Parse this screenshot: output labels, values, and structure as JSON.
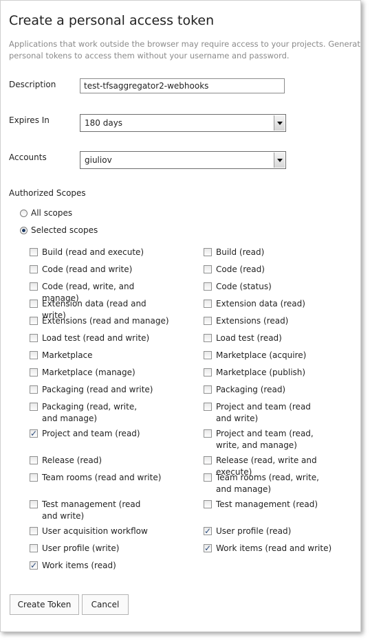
{
  "page": {
    "title": "Create a personal access token",
    "subtitle": "Applications that work outside the browser may require access to your projects. Generate personal tokens to access them without your username and password."
  },
  "form": {
    "description": {
      "label": "Description",
      "value": "test-tfsaggregator2-webhooks"
    },
    "expires": {
      "label": "Expires In",
      "value": "180 days"
    },
    "accounts": {
      "label": "Accounts",
      "value": "giuliov"
    },
    "scopes_label": "Authorized Scopes",
    "all_scopes": {
      "label": "All scopes",
      "checked": false
    },
    "selected_scopes": {
      "label": "Selected scopes",
      "checked": true
    }
  },
  "scopes_left": [
    {
      "label": "Build (read and execute)",
      "checked": false
    },
    {
      "label": "Code (read and write)",
      "checked": false
    },
    {
      "label": "Code (read, write, and manage)",
      "checked": false
    },
    {
      "label": "Extension data (read and write)",
      "checked": false
    },
    {
      "label": "Extensions (read and manage)",
      "checked": false
    },
    {
      "label": "Load test (read and write)",
      "checked": false
    },
    {
      "label": "Marketplace",
      "checked": false
    },
    {
      "label": "Marketplace (manage)",
      "checked": false
    },
    {
      "label": "Packaging (read and write)",
      "checked": false
    },
    {
      "label": "Packaging (read, write, and manage)",
      "checked": false
    },
    {
      "label": "Project and team (read)",
      "checked": true
    },
    {
      "label": "Release (read)",
      "checked": false
    },
    {
      "label": "Team rooms (read and write)",
      "checked": false
    },
    {
      "label": "Test management (read and write)",
      "checked": false
    },
    {
      "label": "User acquisition workflow",
      "checked": false
    },
    {
      "label": "User profile (write)",
      "checked": false
    },
    {
      "label": "Work items (read)",
      "checked": true
    }
  ],
  "scopes_right": [
    {
      "label": "Build (read)",
      "checked": false
    },
    {
      "label": "Code (read)",
      "checked": false
    },
    {
      "label": "Code (status)",
      "checked": false
    },
    {
      "label": "Extension data (read)",
      "checked": false
    },
    {
      "label": "Extensions (read)",
      "checked": false
    },
    {
      "label": "Load test (read)",
      "checked": false
    },
    {
      "label": "Marketplace (acquire)",
      "checked": false
    },
    {
      "label": "Marketplace (publish)",
      "checked": false
    },
    {
      "label": "Packaging (read)",
      "checked": false
    },
    {
      "label": "Project and team (read and write)",
      "checked": false
    },
    {
      "label": "Project and team (read, write, and manage)",
      "checked": false
    },
    {
      "label": "Release (read, write and execute)",
      "checked": false
    },
    {
      "label": "Team rooms (read, write, and manage)",
      "checked": false
    },
    {
      "label": "Test management (read)",
      "checked": false
    },
    {
      "label": "User profile (read)",
      "checked": true
    },
    {
      "label": "Work items (read and write)",
      "checked": true
    }
  ],
  "buttons": {
    "create": "Create Token",
    "cancel": "Cancel"
  }
}
